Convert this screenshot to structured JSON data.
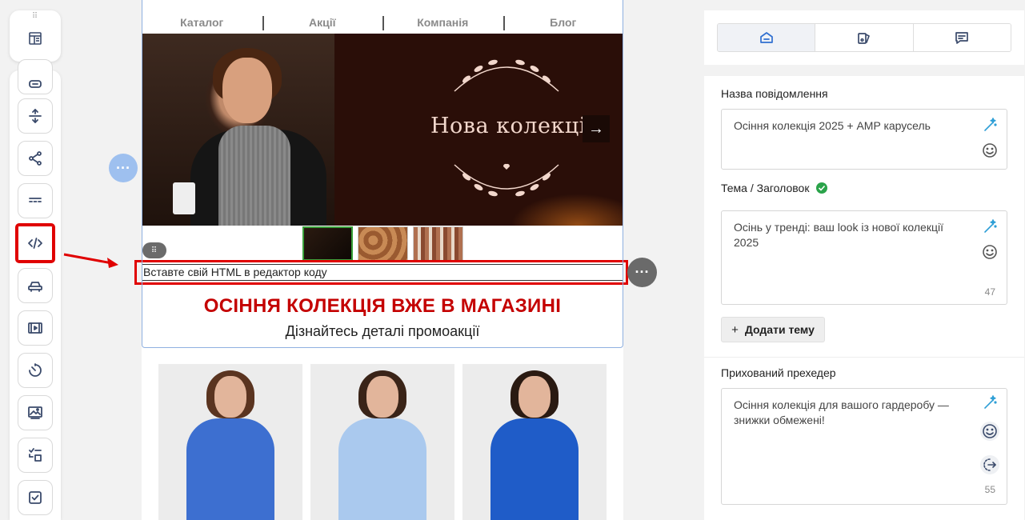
{
  "sidebar": {
    "top_icon": "template-blocks-icon",
    "tools": [
      {
        "name": "button-block-icon"
      },
      {
        "name": "spacer-block-icon"
      },
      {
        "name": "social-share-icon"
      },
      {
        "name": "divider-block-icon"
      },
      {
        "name": "html-code-icon",
        "highlighted": true
      },
      {
        "name": "car-icon"
      },
      {
        "name": "video-block-icon"
      },
      {
        "name": "timer-icon"
      },
      {
        "name": "banner-image-icon"
      },
      {
        "name": "checklist-icon"
      },
      {
        "name": "checkbox-icon"
      }
    ]
  },
  "email": {
    "menu": [
      "Каталог",
      "Акції",
      "Компанія",
      "Блог"
    ],
    "hero_title": "Нова колекція",
    "hero_next": "→",
    "html_placeholder": "Вставте свій HTML в редактор коду",
    "promo_title": "ОСІННЯ КОЛЕКЦІЯ ВЖЕ В МАГАЗИНІ",
    "promo_subtitle": "Дізнайтесь деталі промоакції",
    "more": "···",
    "drag": "⠿"
  },
  "panel": {
    "tabs": [
      "settings-icon",
      "design-icon",
      "comments-icon"
    ],
    "name_label": "Назва повідомлення",
    "name_value": "Осіння колекція 2025 + AMP карусель",
    "subject_label": "Тема / Заголовок",
    "subject_value": "Осінь у тренді: ваш look із нової колекції 2025",
    "subject_count": "47",
    "add_theme_plus": "+",
    "add_theme_label": "Додати тему",
    "preheader_label": "Прихований прехедер",
    "preheader_value": "Осіння колекція для вашого гардеробу — знижки обмежені!",
    "preheader_count": "55"
  },
  "colors": {
    "accent_red": "#e00000",
    "promo_red": "#c40000",
    "selection_blue": "#8fb0e0",
    "ai_magic": "#2f9fd6",
    "check_green": "#2aa34a"
  }
}
